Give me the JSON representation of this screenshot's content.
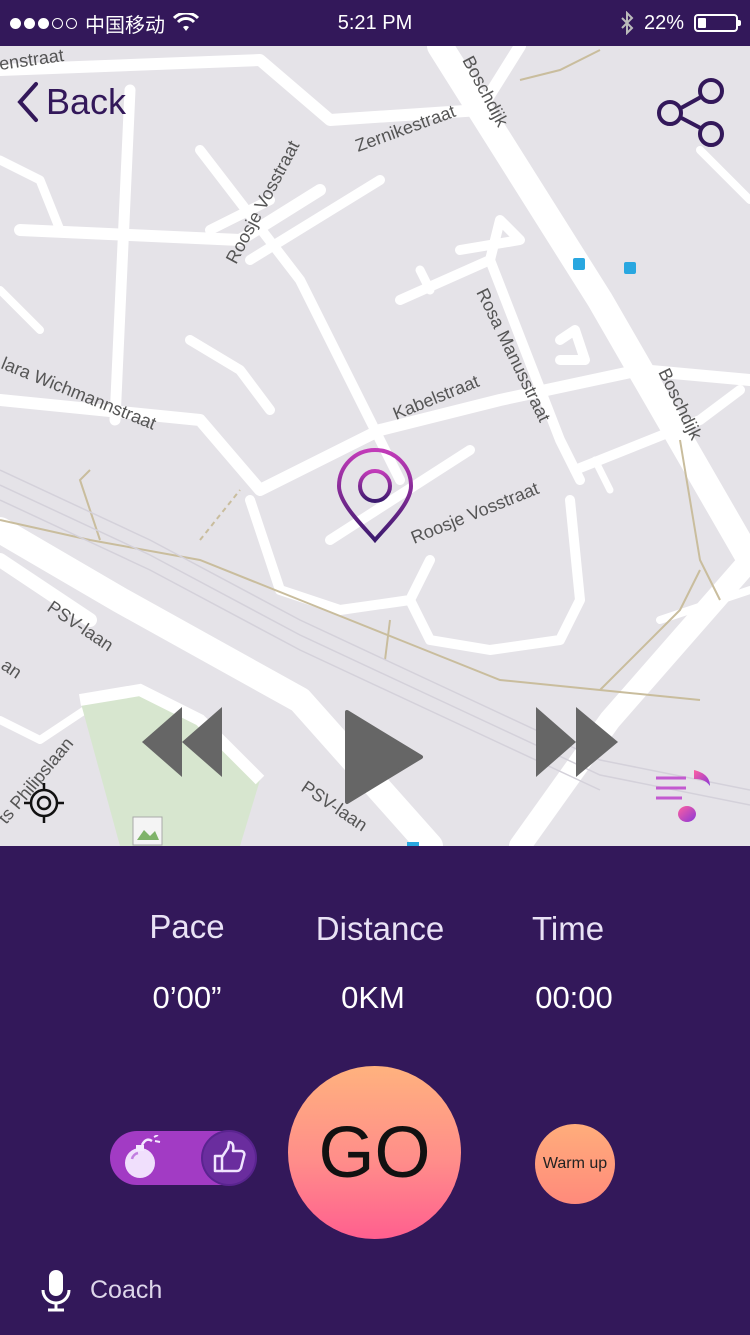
{
  "status_bar": {
    "carrier": "中国移动",
    "time": "5:21 PM",
    "battery": "22%",
    "battery_level": 0.22
  },
  "nav": {
    "back_label": "Back"
  },
  "map": {
    "streets": [
      "enstraat",
      "Boschdijk",
      "Zernikestraat",
      "Roosje Vosstraat",
      "Rosa Manusstraat",
      "Boschdijk",
      "Kabelstraat",
      "lara Wichmannstraat",
      "Roosje Vosstraat",
      "PSV-laan",
      "PSV-laan",
      "ts Philipslaan",
      "an"
    ]
  },
  "stats": {
    "pace": {
      "label": "Pace",
      "value": "0’00”"
    },
    "distance": {
      "label": "Distance",
      "value": "0KM"
    },
    "time": {
      "label": "Time",
      "value": "00:00"
    }
  },
  "actions": {
    "go_label": "GO",
    "warmup_label": "Warm up",
    "coach_label": "Coach"
  },
  "colors": {
    "panel": "#33185a",
    "accent": "#a23bc4",
    "go_top": "#ffb27e",
    "go_bottom": "#ff5f8f"
  }
}
